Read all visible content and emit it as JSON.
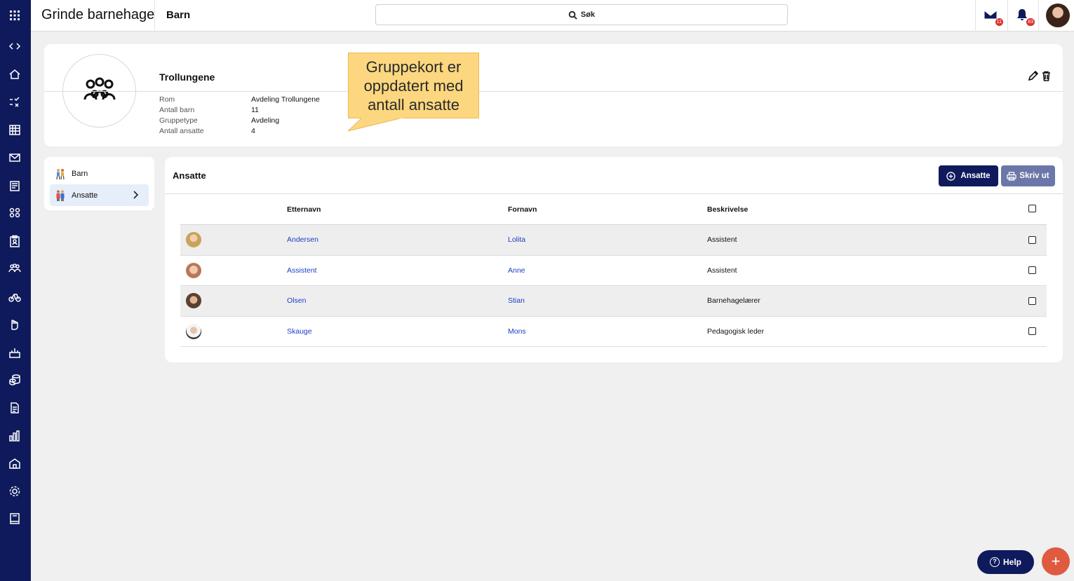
{
  "app": {
    "title": "Grinde barnehage",
    "page_title": "Barn"
  },
  "search": {
    "label": "Søk"
  },
  "notifications": {
    "mail_count": "11",
    "bell_count": "83"
  },
  "rail": {
    "icons": [
      "grid-icon",
      "code-toggle-icon",
      "home-icon",
      "checklist-icon",
      "calendar-icon",
      "mail-icon",
      "news-icon",
      "groups-icon",
      "clipboard-icon",
      "people-icon",
      "bike-icon",
      "hand-icon",
      "cake-icon",
      "coins-icon",
      "document-icon",
      "chart-icon",
      "school-icon",
      "settings-icon",
      "book-icon"
    ]
  },
  "group": {
    "name": "Trollungene",
    "fields": [
      {
        "label": "Rom",
        "value": "Avdeling Trollungene"
      },
      {
        "label": "Antall barn",
        "value": "11"
      },
      {
        "label": "Gruppetype",
        "value": "Avdeling"
      },
      {
        "label": "Antall ansatte",
        "value": "4"
      }
    ]
  },
  "callout": {
    "text": "Gruppekort er oppdatert med antall ansatte",
    "color": "#fcd77f"
  },
  "side_menu": {
    "items": [
      {
        "label": "Barn",
        "icon": "children-icon"
      },
      {
        "label": "Ansatte",
        "icon": "staff-icon",
        "active": true
      }
    ]
  },
  "panel": {
    "title": "Ansatte",
    "add_button": "Ansatte",
    "print_button": "Skriv ut",
    "columns": [
      "Etternavn",
      "Fornavn",
      "Beskrivelse"
    ],
    "rows": [
      {
        "last": "Andersen",
        "first": "Lolita",
        "desc": "Assistent"
      },
      {
        "last": "Assistent",
        "first": "Anne",
        "desc": "Assistent"
      },
      {
        "last": "Olsen",
        "first": "Stian",
        "desc": "Barnehagelærer"
      },
      {
        "last": "Skauge",
        "first": "Mons",
        "desc": "Pedagogisk leder"
      }
    ]
  },
  "help": {
    "label": "Help"
  },
  "colors": {
    "brand": "#0f1a5c",
    "link": "#1a3fc4",
    "fab": "#e05a3f",
    "print": "#6b77a8"
  }
}
